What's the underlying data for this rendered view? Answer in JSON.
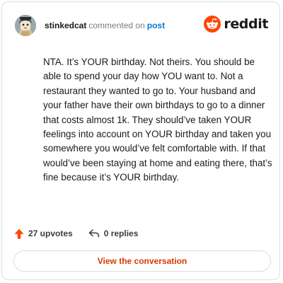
{
  "comment": {
    "username": "stinkedcat",
    "commented_on_text": "commented on",
    "post_link_label": "post",
    "body": "NTA. It’s YOUR birthday. Not theirs. You should be able to spend your day how YOU want to. Not a restaurant they wanted to go to. Your husband and your father have their own birthdays to go to a dinner that costs almost 1k. They should’ve taken YOUR feelings into account on YOUR birthday and taken you somewhere you would’ve felt comfortable with. If that would’ve been staying at home and eating there, that’s fine because it’s YOUR birthday."
  },
  "brand": {
    "logo_text": "reddit",
    "logo_icon": "reddit-snoo-icon",
    "brand_color": "#ff4500"
  },
  "actions": {
    "upvotes_label": "27 upvotes",
    "upvote_icon": "upvote-arrow-icon",
    "upvote_color": "#ff4500",
    "replies_label": "0 replies",
    "reply_icon": "reply-arrow-icon"
  },
  "footer": {
    "view_conversation_label": "View the conversation",
    "link_color": "#d93a00"
  }
}
